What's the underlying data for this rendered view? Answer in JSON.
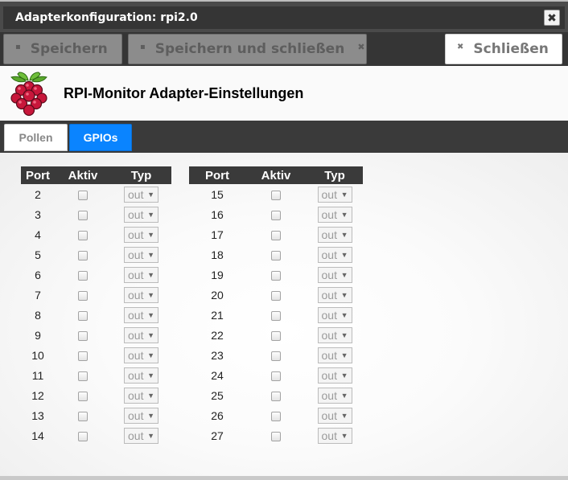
{
  "window": {
    "title": "Adapterkonfiguration: rpi2.0"
  },
  "toolbar": {
    "save_label": "Speichern",
    "save_close_label": "Speichern und schließen",
    "close_label": "Schließen"
  },
  "header": {
    "title": "RPI-Monitor Adapter-Einstellungen"
  },
  "tabs": [
    {
      "label": "Pollen",
      "active": false
    },
    {
      "label": "GPIOs",
      "active": true
    }
  ],
  "gpio_table": {
    "headers": {
      "port": "Port",
      "active": "Aktiv",
      "type": "Typ"
    },
    "left": [
      {
        "port": "2",
        "active": false,
        "type": "out"
      },
      {
        "port": "3",
        "active": false,
        "type": "out"
      },
      {
        "port": "4",
        "active": false,
        "type": "out"
      },
      {
        "port": "5",
        "active": false,
        "type": "out"
      },
      {
        "port": "6",
        "active": false,
        "type": "out"
      },
      {
        "port": "7",
        "active": false,
        "type": "out"
      },
      {
        "port": "8",
        "active": false,
        "type": "out"
      },
      {
        "port": "9",
        "active": false,
        "type": "out"
      },
      {
        "port": "10",
        "active": false,
        "type": "out"
      },
      {
        "port": "11",
        "active": false,
        "type": "out"
      },
      {
        "port": "12",
        "active": false,
        "type": "out"
      },
      {
        "port": "13",
        "active": false,
        "type": "out"
      },
      {
        "port": "14",
        "active": false,
        "type": "out"
      }
    ],
    "right": [
      {
        "port": "15",
        "active": false,
        "type": "out"
      },
      {
        "port": "16",
        "active": false,
        "type": "out"
      },
      {
        "port": "17",
        "active": false,
        "type": "out"
      },
      {
        "port": "18",
        "active": false,
        "type": "out"
      },
      {
        "port": "19",
        "active": false,
        "type": "out"
      },
      {
        "port": "20",
        "active": false,
        "type": "out"
      },
      {
        "port": "21",
        "active": false,
        "type": "out"
      },
      {
        "port": "22",
        "active": false,
        "type": "out"
      },
      {
        "port": "23",
        "active": false,
        "type": "out"
      },
      {
        "port": "24",
        "active": false,
        "type": "out"
      },
      {
        "port": "25",
        "active": false,
        "type": "out"
      },
      {
        "port": "26",
        "active": false,
        "type": "out"
      },
      {
        "port": "27",
        "active": false,
        "type": "out"
      }
    ]
  },
  "icons": {
    "save": "floppy-icon",
    "close_small": "x-icon",
    "close_window": "close-icon",
    "logo": "raspberry-pi-logo"
  },
  "colors": {
    "title_bar": "#353535",
    "active_tab": "#0a84ff",
    "table_header": "#3a3a3a"
  }
}
